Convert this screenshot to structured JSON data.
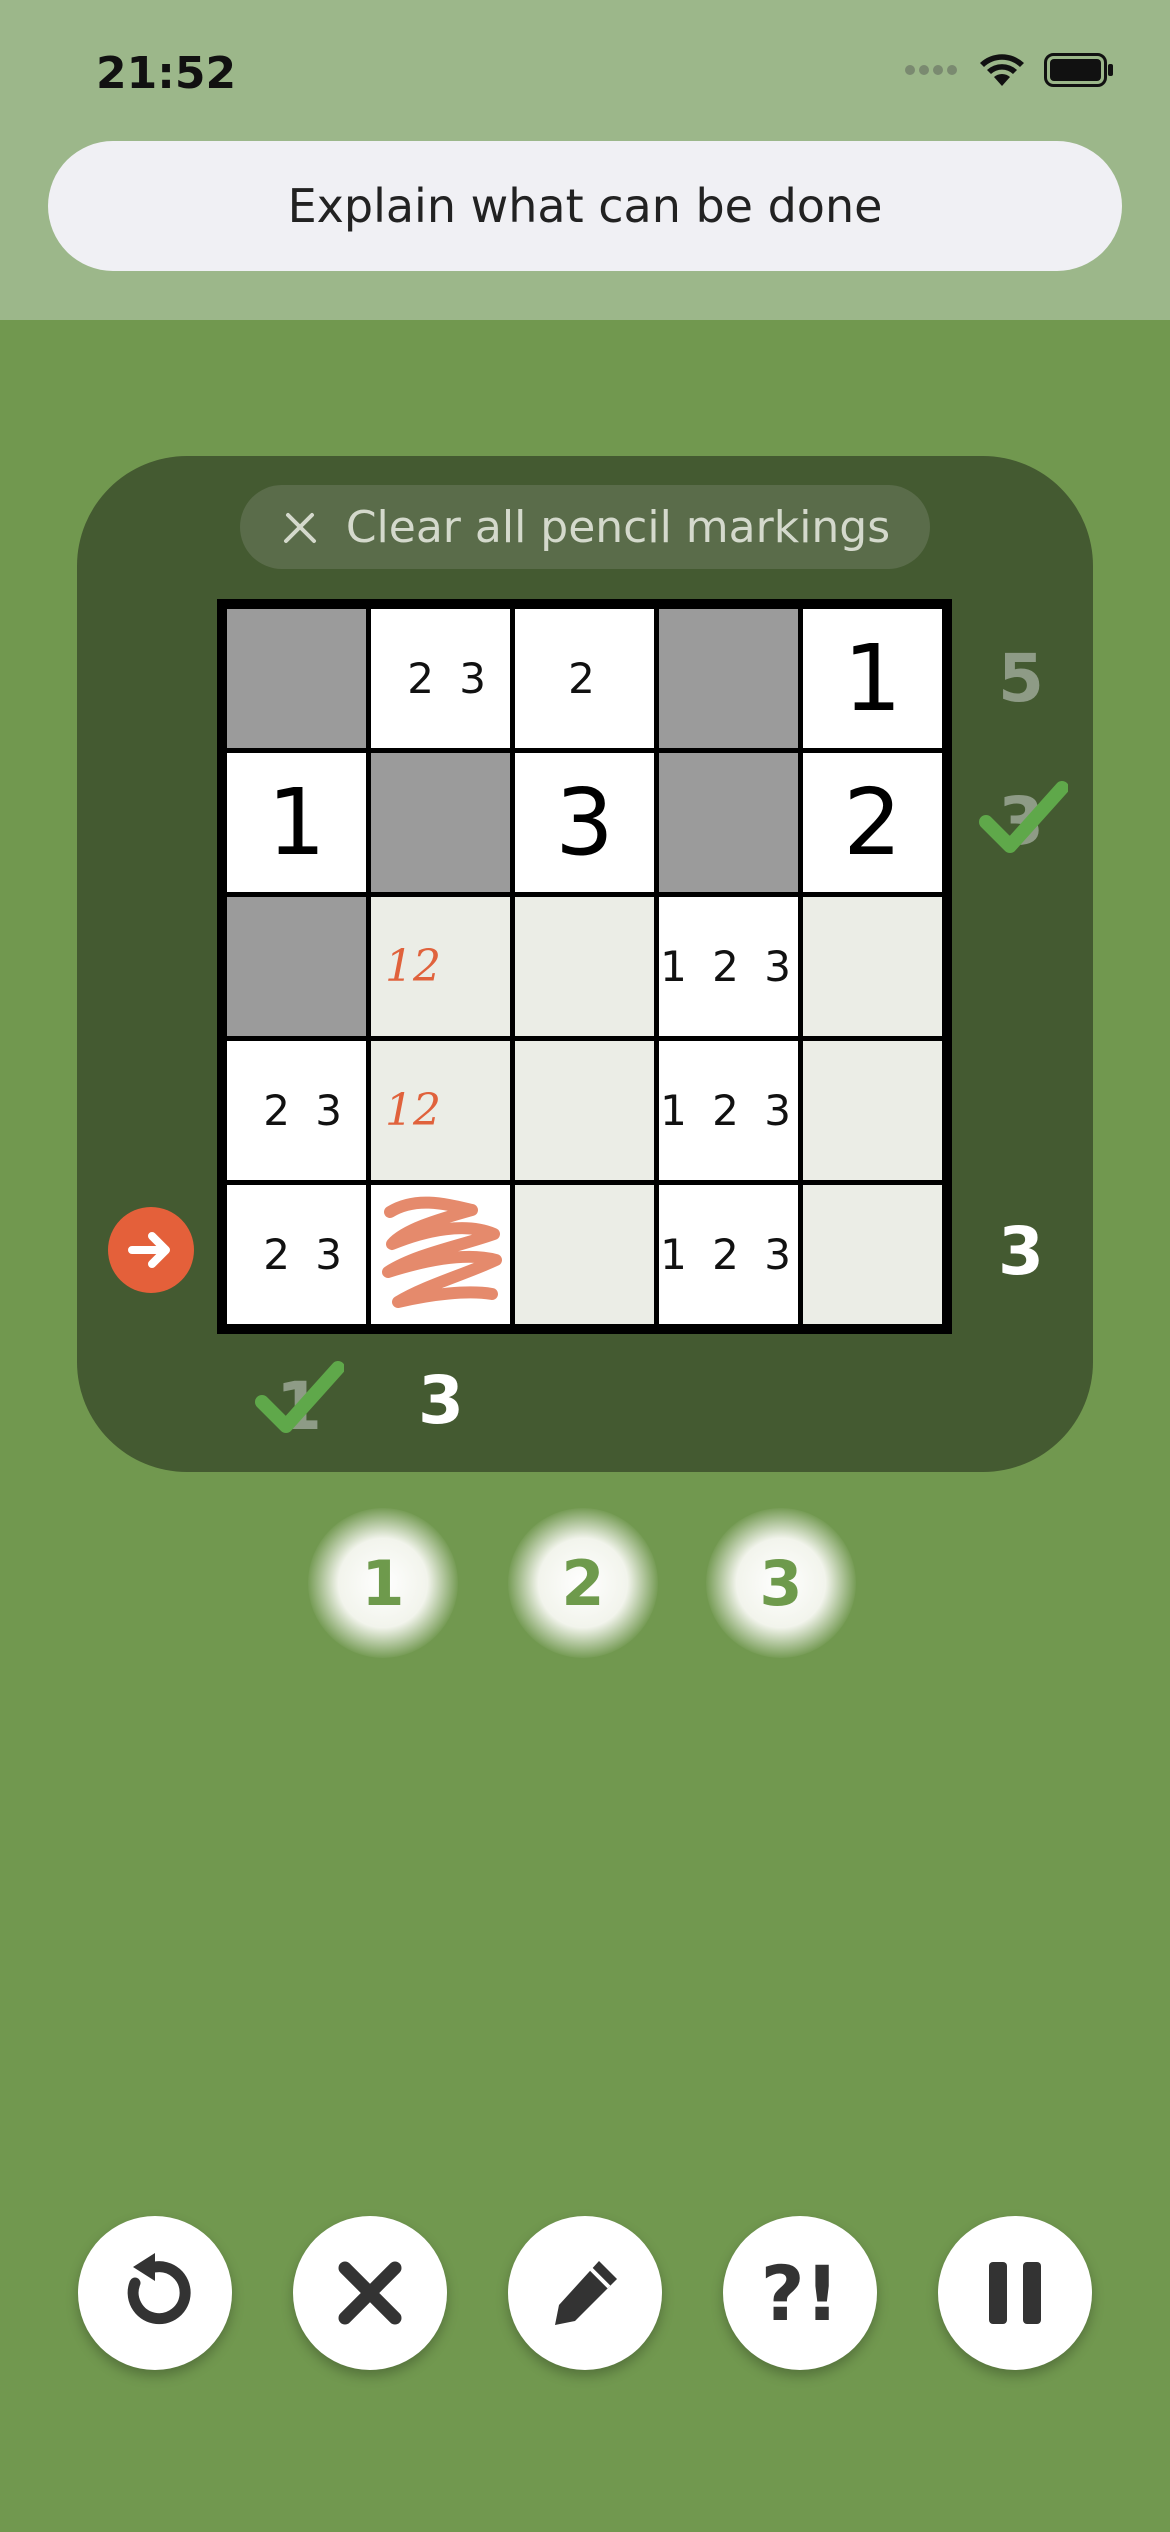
{
  "status_bar": {
    "time": "21:52",
    "icons": [
      "cellular-signal-icon",
      "wifi-icon",
      "battery-icon"
    ]
  },
  "explain_button": {
    "label": "Explain what can be done"
  },
  "clear_button": {
    "label": "Clear all pencil markings",
    "icon": "pencil-off-icon"
  },
  "grid": {
    "rows": [
      [
        {
          "type": "shaded"
        },
        {
          "type": "pencil",
          "text": "2 3"
        },
        {
          "type": "pencil",
          "text": "2"
        },
        {
          "type": "shaded"
        },
        {
          "type": "digit",
          "text": "1"
        }
      ],
      [
        {
          "type": "digit",
          "text": "1"
        },
        {
          "type": "shaded"
        },
        {
          "type": "digit",
          "text": "3"
        },
        {
          "type": "shaded"
        },
        {
          "type": "digit",
          "text": "2"
        }
      ],
      [
        {
          "type": "shaded"
        },
        {
          "type": "pencil-red",
          "text": "12"
        },
        {
          "type": "empty"
        },
        {
          "type": "pencil",
          "text": "1 2 3"
        },
        {
          "type": "empty"
        }
      ],
      [
        {
          "type": "pencil-right",
          "text": "2 3"
        },
        {
          "type": "pencil-red",
          "text": "12"
        },
        {
          "type": "empty"
        },
        {
          "type": "pencil",
          "text": "1 2 3"
        },
        {
          "type": "empty"
        }
      ],
      [
        {
          "type": "pencil-right",
          "text": "2 3"
        },
        {
          "type": "scribble"
        },
        {
          "type": "empty"
        },
        {
          "type": "pencil",
          "text": "1 2 3"
        },
        {
          "type": "empty"
        }
      ]
    ]
  },
  "row_clues": {
    "row1": {
      "value": "5",
      "color": "#8e9b86"
    },
    "row2": {
      "value": "3",
      "solved": true
    },
    "row5": {
      "value": "3",
      "color": "#ffffff"
    }
  },
  "column_clues": {
    "col1": {
      "value": "1",
      "solved": true
    },
    "col2": {
      "value": "3",
      "color": "#ffffff"
    }
  },
  "number_pad": [
    "1",
    "2",
    "3"
  ],
  "toolbar": {
    "undo_icon": "undo-icon",
    "erase_icon": "close-icon",
    "pencil_icon": "pencil-icon",
    "hint_label": "?!",
    "pause_icon": "pause-icon"
  },
  "colors": {
    "background": "#71984f",
    "panel": "#445a31",
    "accent": "#e4603a",
    "check": "#5fa84a"
  }
}
